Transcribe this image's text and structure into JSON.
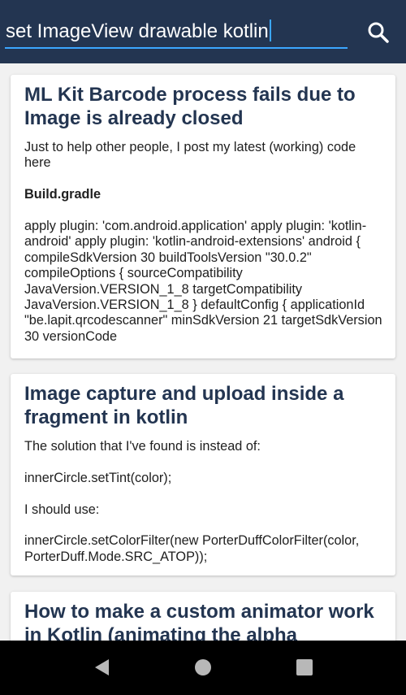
{
  "search": {
    "query": "set ImageView drawable kotlin"
  },
  "results": [
    {
      "title": "ML Kit Barcode process fails due to Image is already closed",
      "paragraphs": [
        "Just to help other people, I post my latest (working) code here",
        "Build.gradle",
        "apply plugin: 'com.android.application' apply plugin: 'kotlin-android' apply plugin: 'kotlin-android-extensions' android { compileSdkVersion 30 buildToolsVersion \"30.0.2\" compileOptions { sourceCompatibility JavaVersion.VERSION_1_8 targetCompatibility JavaVersion.VERSION_1_8 } defaultConfig { applicationId \"be.lapit.qrcodescanner\" minSdkVersion 21 targetSdkVersion 30 versionCode"
      ]
    },
    {
      "title": "Image capture and upload inside a fragment in kotlin",
      "paragraphs": [
        "The solution that I've found is instead of:",
        "innerCircle.setTint(color);",
        "I should use:",
        "innerCircle.setColorFilter(new PorterDuffColorFilter(color, PorterDuff.Mode.SRC_ATOP));"
      ]
    },
    {
      "title": "How to make a custom animator work in Kotlin (animating the alpha property)"
    }
  ],
  "colors": {
    "appbar": "#233551",
    "accent": "#3ba6ff",
    "title": "#233551"
  },
  "navbar": {
    "back_icon": "triangle-back-icon",
    "home_icon": "circle-home-icon",
    "recents_icon": "square-recents-icon"
  }
}
